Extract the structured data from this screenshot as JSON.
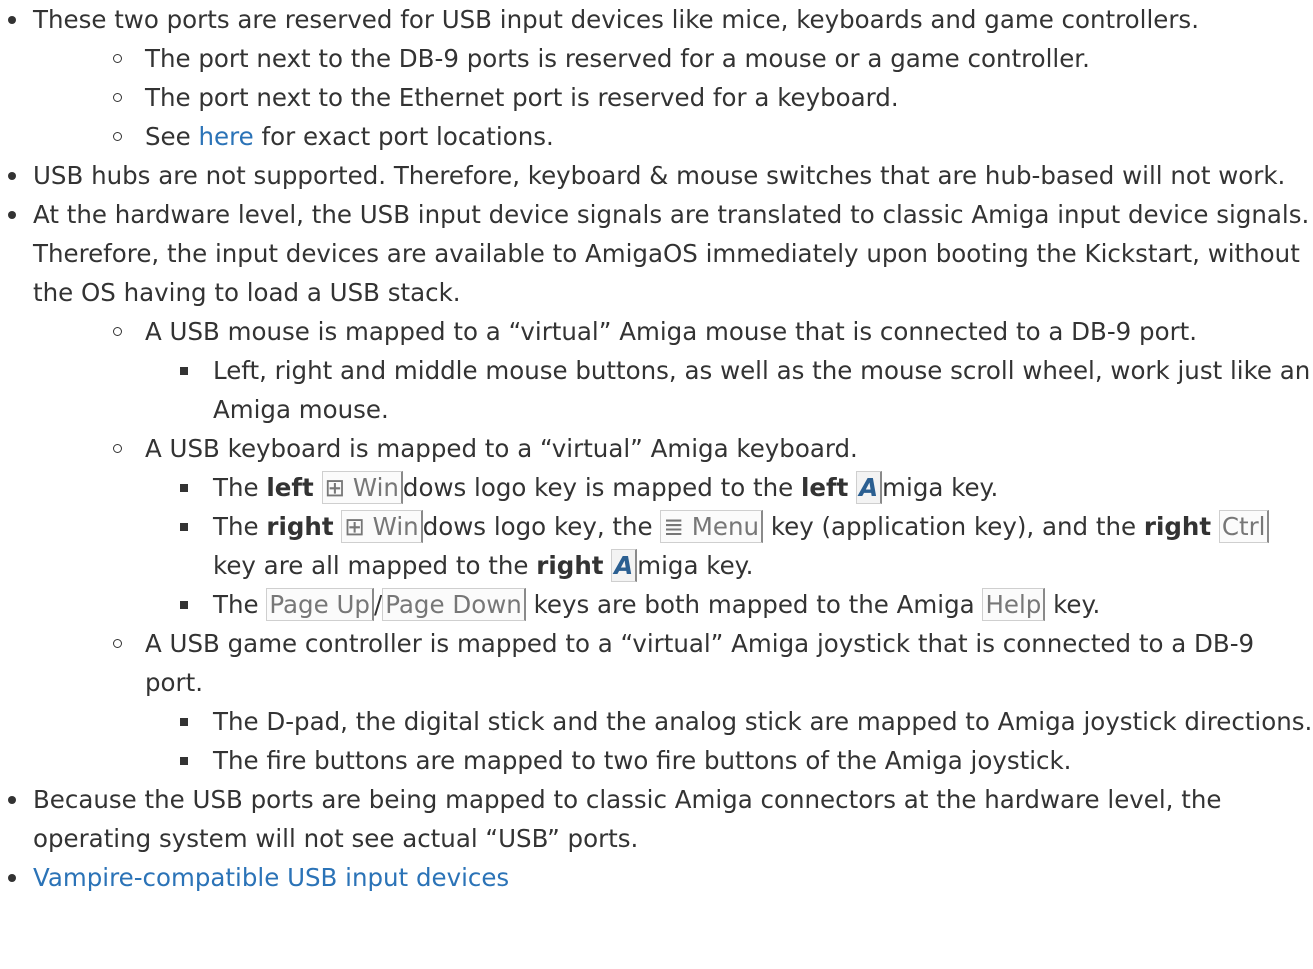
{
  "items": {
    "i1": "These two ports are reserved for USB input devices like mice, keyboards and game controllers.",
    "i1_sub1": "The port next to the DB-9 ports is reserved for a mouse or a game controller.",
    "i1_sub2": "The port next to the Ethernet port is reserved for a keyboard.",
    "i1_sub3_pre": "See",
    "i1_sub3_link": "here",
    "i1_sub3_post": "for exact port locations.",
    "i2": "USB hubs are not supported. Therefore, keyboard & mouse switches that are hub-based will not work.",
    "i3": "At the hardware level, the USB input device signals are translated to classic Amiga input device signals. Therefore, the input devices are available to AmigaOS immediately upon booting the Kickstart, without the OS having to load a USB stack.",
    "i3_sub1": "A USB mouse is mapped to a “virtual” Amiga mouse that is connected to a DB-9 port.",
    "i3_sub1_a": "Left, right and middle mouse buttons, as well as the mouse scroll wheel, work just like an Amiga mouse.",
    "i3_sub2": "A USB keyboard is mapped to a “virtual” Amiga keyboard.",
    "k1_the": "The",
    "k1_left": "left",
    "k1_key": "⊞ Win",
    "k1_mid": "dows logo key is mapped to the",
    "k1_left2": "left",
    "k1_amiga": "A",
    "k1_end": "miga key.",
    "k2_the": "The",
    "k2_right": "right",
    "k2_key": "⊞ Win",
    "k2_mid": "dows logo key, the",
    "k2_menu": "≣ Menu",
    "k2_mid2": "key (application key), and the",
    "k2_right2": "right",
    "k2_ctrl": "Ctrl",
    "k2_mid3": "key are all mapped to the",
    "k2_right3": "right",
    "k2_amiga": "A",
    "k2_end": "miga key.",
    "k3_the": "The",
    "k3_pgup": "Page Up",
    "k3_slash": "/",
    "k3_pgdn": "Page Down",
    "k3_mid": "keys are both mapped to the Amiga",
    "k3_help": "Help",
    "k3_end": "key.",
    "i3_sub3": "A USB game controller is mapped to a “virtual” Amiga joystick that is connected to a DB-9 port.",
    "i3_sub3_a": "The D-pad, the digital stick and the analog stick are mapped to Amiga joystick directions.",
    "i3_sub3_b": "The fire buttons are mapped to two fire buttons of the Amiga joystick.",
    "i4": "Because the USB ports are being mapped to classic Amiga connectors at the hardware level, the operating system will not see actual “USB” ports.",
    "i5_link": "Vampire-compatible USB input devices"
  }
}
